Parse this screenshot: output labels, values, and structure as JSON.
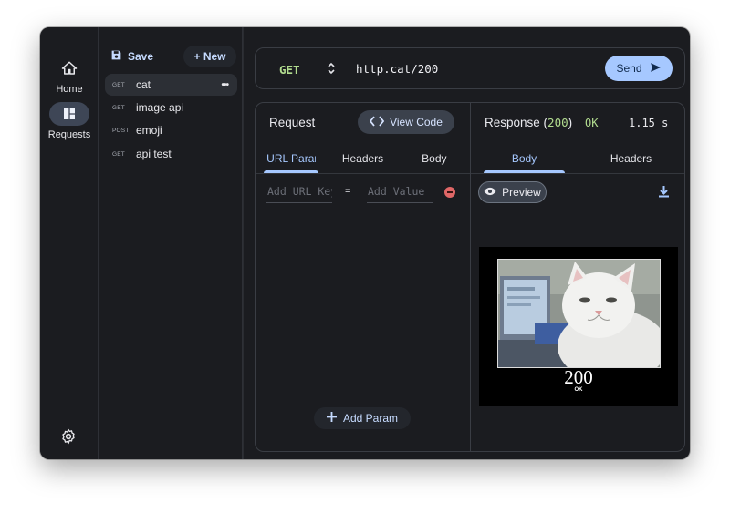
{
  "nav": {
    "home_label": "Home",
    "requests_label": "Requests",
    "settings_icon": "gear-icon"
  },
  "sidebar": {
    "save_label": "Save",
    "new_label": "+ New",
    "items": [
      {
        "method": "GET",
        "name": "cat",
        "active": true,
        "more": "•••"
      },
      {
        "method": "GET",
        "name": "image api"
      },
      {
        "method": "POST",
        "name": "emoji"
      },
      {
        "method": "GET",
        "name": "api test"
      }
    ]
  },
  "request_bar": {
    "method": "GET",
    "url": "http.cat/200",
    "send_label": "Send"
  },
  "request_pane": {
    "title": "Request",
    "view_code_label": "View Code",
    "tabs": [
      "URL Params",
      "Headers",
      "Body"
    ],
    "active_tab": "URL Params",
    "param_key_placeholder": "Add URL Key",
    "param_eq": "=",
    "param_value_placeholder": "Add Value",
    "add_param_label": "Add Param"
  },
  "response_pane": {
    "title_prefix": "Response (",
    "status_code": "200",
    "title_suffix": ")",
    "status_text": "OK",
    "timing": "1.15 s",
    "tabs": [
      "Body",
      "Headers"
    ],
    "active_tab": "Body",
    "preview_label": "Preview",
    "image_caption_code": "200",
    "image_caption_text": "OK"
  },
  "colors": {
    "accent": "#a6c8ff",
    "method_get": "#b2dc8f",
    "danger": "#e06767",
    "background": "#1b1c20"
  }
}
